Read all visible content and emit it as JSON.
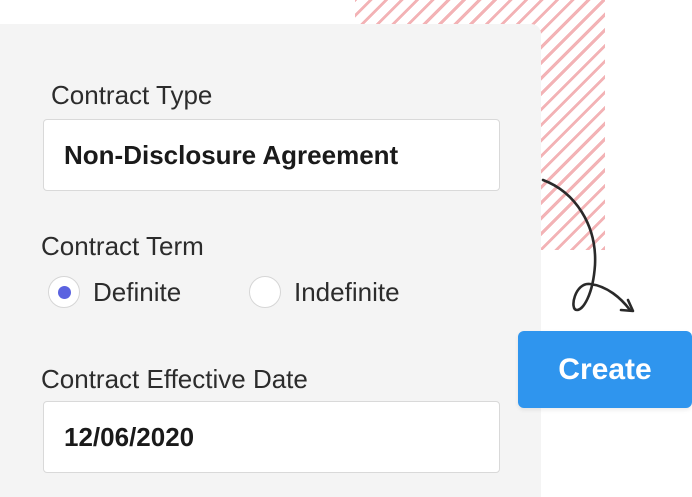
{
  "form": {
    "contract_type": {
      "label": "Contract Type",
      "value": "Non-Disclosure Agreement"
    },
    "contract_term": {
      "label": "Contract Term",
      "options": [
        {
          "label": "Definite",
          "selected": true
        },
        {
          "label": "Indefinite",
          "selected": false
        }
      ]
    },
    "effective_date": {
      "label": "Contract Effective Date",
      "value": "12/06/2020"
    }
  },
  "actions": {
    "create_label": "Create"
  },
  "colors": {
    "accent": "#2f95ee",
    "radio_selected": "#5b63e0",
    "stripes": "#e97479",
    "card_background": "#f4f4f4"
  },
  "icons": {
    "decoration": "curly-arrow-icon"
  }
}
